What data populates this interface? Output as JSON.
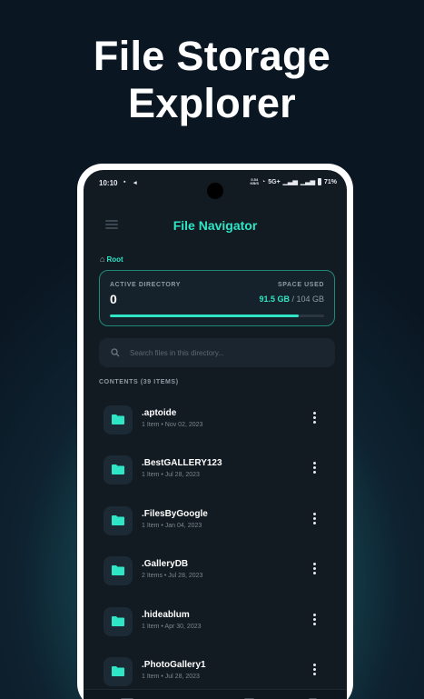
{
  "headline": {
    "line1": "File Storage",
    "line2": "Explorer"
  },
  "status_bar": {
    "time": "10:10",
    "network_speed_top": "0.54",
    "network_speed_bottom": "KB/S",
    "network": "5G+",
    "battery": "71%"
  },
  "app_bar": {
    "title": "File Navigator"
  },
  "breadcrumb": {
    "root": "Root"
  },
  "directory_card": {
    "active_label": "ACTIVE DIRECTORY",
    "active_value": "0",
    "space_label": "SPACE USED",
    "space_used": "91.5 GB",
    "space_total": " / 104 GB",
    "usage_fraction": 0.88
  },
  "search": {
    "placeholder": "Search files in this directory..."
  },
  "contents": {
    "label": "CONTENTS (39 ITEMS)"
  },
  "items": [
    {
      "name": ".aptoide",
      "meta": "1 Item • Nov 02, 2023"
    },
    {
      "name": ".BestGALLERY123",
      "meta": "1 Item • Jul 28, 2023"
    },
    {
      "name": ".FilesByGoogle",
      "meta": "1 Item • Jan 04, 2023"
    },
    {
      "name": ".GalleryDB",
      "meta": "2 Items • Jul 28, 2023"
    },
    {
      "name": ".hideablum",
      "meta": "1 Item • Apr 30, 2023"
    },
    {
      "name": ".PhotoGallery1",
      "meta": "1 Item • Jul 28, 2023"
    }
  ],
  "colors": {
    "accent": "#2ee6c5",
    "background": "#121a22",
    "card": "#16222b"
  },
  "icons": [
    "menu-icon",
    "home-icon",
    "search-icon",
    "folder-icon",
    "more-vert-icon"
  ]
}
